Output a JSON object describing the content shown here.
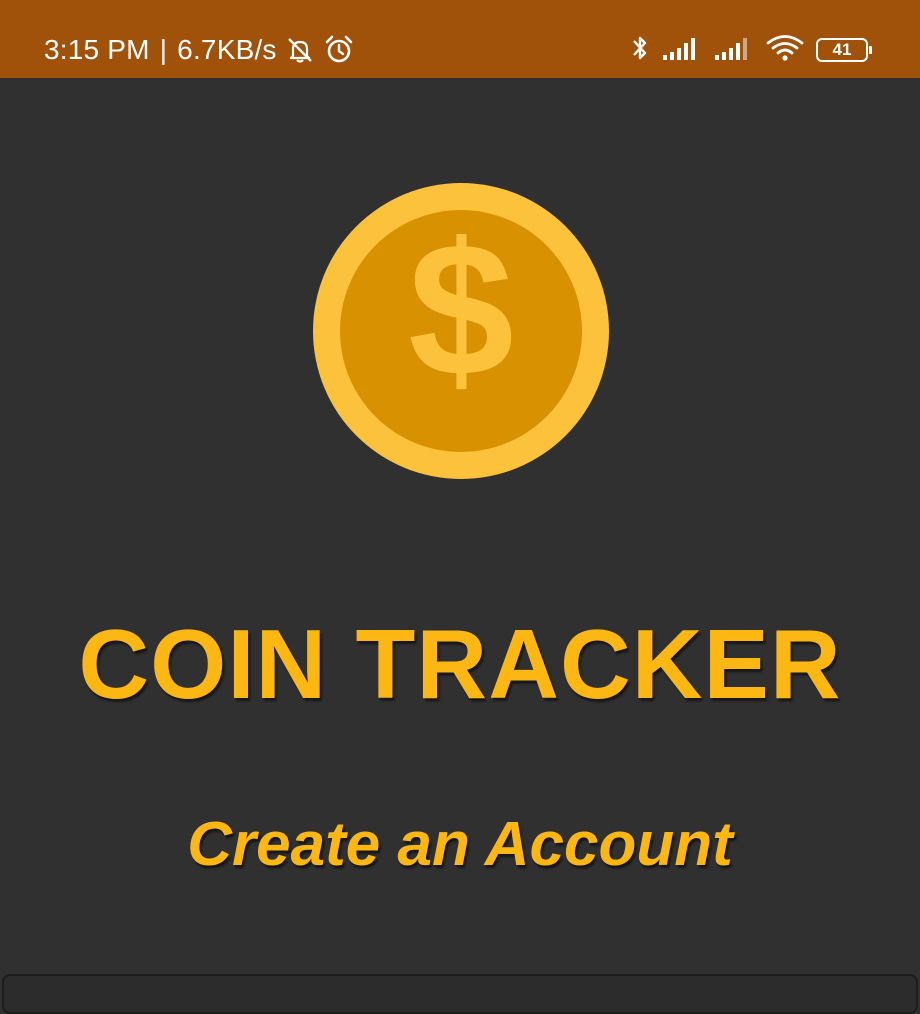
{
  "status_bar": {
    "time": "3:15 PM",
    "separator": "|",
    "network_speed": "6.7KB/s",
    "battery_level": "41",
    "icons": [
      "bell-off-icon",
      "alarm-icon",
      "bluetooth-icon",
      "signal-icon",
      "signal-icon",
      "wifi-icon",
      "battery-icon"
    ]
  },
  "logo": {
    "icon": "dollar-coin-icon",
    "symbol": "$"
  },
  "app_title": "COIN TRACKER",
  "subtitle": "Create an Account",
  "colors": {
    "status_bar": "#a0510a",
    "background": "#303030",
    "accent": "#fdb713",
    "coin_outer": "#fcc23c",
    "coin_inner": "#d89100"
  }
}
